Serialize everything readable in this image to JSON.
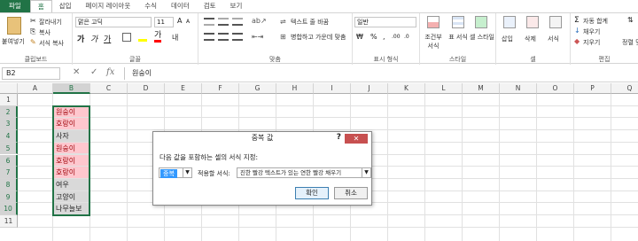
{
  "tabs": [
    "파일",
    "홈",
    "삽입",
    "페이지 레이아웃",
    "수식",
    "데이터",
    "검토",
    "보기"
  ],
  "ribbon": {
    "clipboard": {
      "paste": "붙여넣기",
      "cut": "잘라내기",
      "copy": "복사",
      "format_painter": "서식 복사",
      "label": "클립보드"
    },
    "font": {
      "name": "맑은 고딕",
      "size": "11",
      "label": "글꼴"
    },
    "align": {
      "wrap": "텍스트 줄 바꿈",
      "merge": "병합하고 가운데 맞춤",
      "label": "맞춤"
    },
    "number": {
      "format": "일반",
      "label": "표시 형식"
    },
    "styles": {
      "cond": "조건부 서식",
      "table": "표 서식",
      "cell": "셀 스타일",
      "label": "스타일"
    },
    "cells": {
      "insert": "삽입",
      "delete": "삭제",
      "format": "서식",
      "label": "셀"
    },
    "edit": {
      "autosum": "자동 합계",
      "fill": "채우기",
      "clear": "지우기",
      "sort": "정렬 및 필터",
      "label": "편집"
    }
  },
  "formula": {
    "name_box": "B2",
    "fx": "fx",
    "value": "원숭이"
  },
  "grid": {
    "columns": [
      "A",
      "B",
      "C",
      "D",
      "E",
      "F",
      "G",
      "H",
      "I",
      "J",
      "K",
      "L",
      "M",
      "N",
      "O",
      "P",
      "Q"
    ],
    "rows": [
      "1",
      "2",
      "3",
      "4",
      "5",
      "6",
      "7",
      "8",
      "9",
      "10",
      "11"
    ],
    "b_cells": [
      {
        "text": "",
        "style": ""
      },
      {
        "text": "원숭이",
        "style": "dup"
      },
      {
        "text": "호랑이",
        "style": "dup"
      },
      {
        "text": "사자",
        "style": "nodup"
      },
      {
        "text": "원숭이",
        "style": "dup"
      },
      {
        "text": "호랑이",
        "style": "dup"
      },
      {
        "text": "호랑이",
        "style": "dup"
      },
      {
        "text": "여우",
        "style": "nodup"
      },
      {
        "text": "고양이",
        "style": "nodup"
      },
      {
        "text": "나무늘보",
        "style": "nodup"
      },
      {
        "text": "",
        "style": ""
      }
    ]
  },
  "dialog": {
    "title": "중복 값",
    "help": "?",
    "close": "✕",
    "instruction": "다음 값을 포함하는 셀의 서식 지정:",
    "type": "중복",
    "apply_label": "적용할 서식:",
    "format": "진한 빨강 텍스트가 있는 연한 빨강 채우기",
    "ok": "확인",
    "cancel": "취소"
  },
  "colors": {
    "accent": "#217346",
    "dup_fill": "#ffc7ce",
    "dup_text": "#9c0006",
    "close_btn": "#c75050"
  }
}
